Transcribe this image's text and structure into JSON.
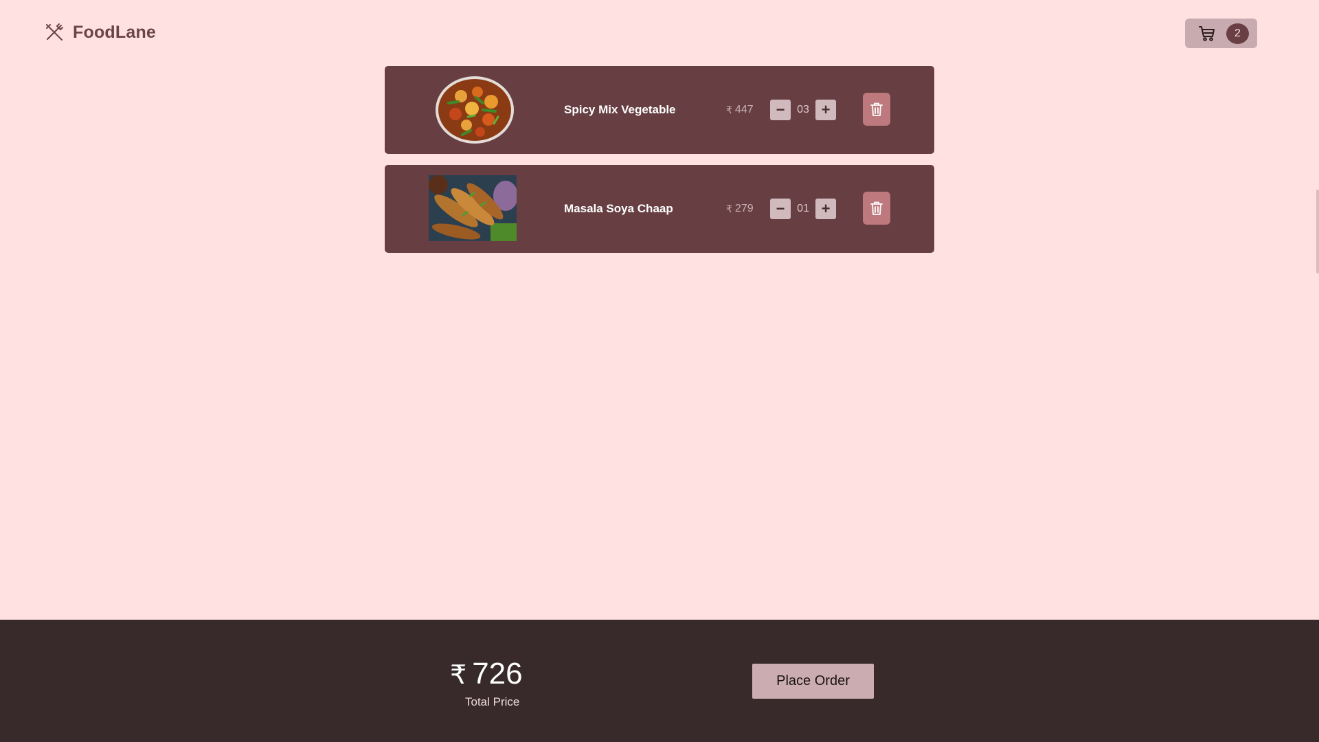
{
  "header": {
    "brand": "FoodLane",
    "logo_icon": "fork-knife-icon",
    "cart_icon": "shopping-cart-icon",
    "cart_count": "2"
  },
  "cart": {
    "items": [
      {
        "name": "Spicy Mix Vegetable",
        "currency": "₹",
        "price": "447",
        "quantity": "03",
        "decrement": "−",
        "increment": "+",
        "delete_icon": "trash-icon"
      },
      {
        "name": "Masala Soya Chaap",
        "currency": "₹",
        "price": "279",
        "quantity": "01",
        "decrement": "−",
        "increment": "+",
        "delete_icon": "trash-icon"
      }
    ]
  },
  "footer": {
    "currency": "₹",
    "total": "726",
    "total_label": "Total Price",
    "place_order_label": "Place Order"
  },
  "colors": {
    "background": "#ffe1e1",
    "card": "#673f42",
    "footer": "#382a2b",
    "accent": "#cbadb1",
    "delete": "#bd797d"
  }
}
